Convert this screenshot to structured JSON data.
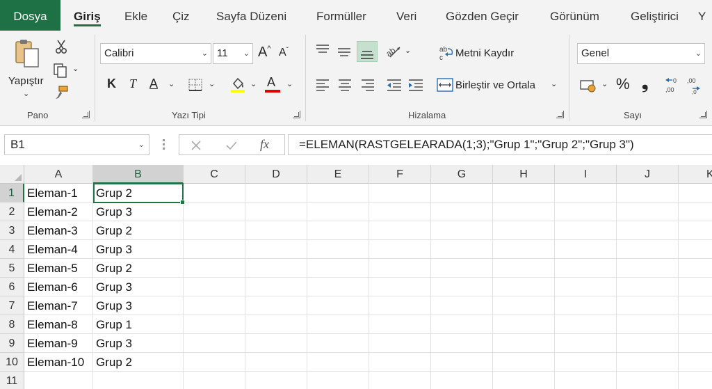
{
  "tabs": [
    "Dosya",
    "Giriş",
    "Ekle",
    "Çiz",
    "Sayfa Düzeni",
    "Formüller",
    "Veri",
    "Gözden Geçir",
    "Görünüm",
    "Geliştirici",
    "Y"
  ],
  "ribbon": {
    "clipboard": {
      "paste_label": "Yapıştır",
      "group_label": "Pano"
    },
    "font": {
      "font_name": "Calibri",
      "font_size": "11",
      "bold": "K",
      "italic": "T",
      "underline": "A",
      "font_color_letter": "A",
      "group_label": "Yazı Tipi",
      "highlight_color": "#ffff00",
      "font_color": "#e00000"
    },
    "alignment": {
      "wrap_text": "Metni Kaydır",
      "merge_center": "Birleştir ve Ortala",
      "group_label": "Hizalama"
    },
    "number": {
      "format": "Genel",
      "percent": "%",
      "comma": "❟",
      "group_label": "Sayı"
    }
  },
  "formula_bar": {
    "name_box": "B1",
    "fx": "fx",
    "formula": "=ELEMAN(RASTGELEARADA(1;3);\"Grup 1\";\"Grup 2\";\"Grup 3\")"
  },
  "columns": [
    "A",
    "B",
    "C",
    "D",
    "E",
    "F",
    "G",
    "H",
    "I",
    "J",
    "K"
  ],
  "rows": [
    {
      "num": "1",
      "a": "Eleman-1",
      "b": "Grup 2"
    },
    {
      "num": "2",
      "a": "Eleman-2",
      "b": "Grup 3"
    },
    {
      "num": "3",
      "a": "Eleman-3",
      "b": "Grup 2"
    },
    {
      "num": "4",
      "a": "Eleman-4",
      "b": "Grup 3"
    },
    {
      "num": "5",
      "a": "Eleman-5",
      "b": "Grup 2"
    },
    {
      "num": "6",
      "a": "Eleman-6",
      "b": "Grup 3"
    },
    {
      "num": "7",
      "a": "Eleman-7",
      "b": "Grup 3"
    },
    {
      "num": "8",
      "a": "Eleman-8",
      "b": "Grup 1"
    },
    {
      "num": "9",
      "a": "Eleman-9",
      "b": "Grup 3"
    },
    {
      "num": "10",
      "a": "Eleman-10",
      "b": "Grup 2"
    },
    {
      "num": "11",
      "a": "",
      "b": ""
    }
  ],
  "selection": {
    "column": "B",
    "row": "1"
  },
  "colors": {
    "accent": "#217346",
    "file_tab": "#1e7145"
  }
}
